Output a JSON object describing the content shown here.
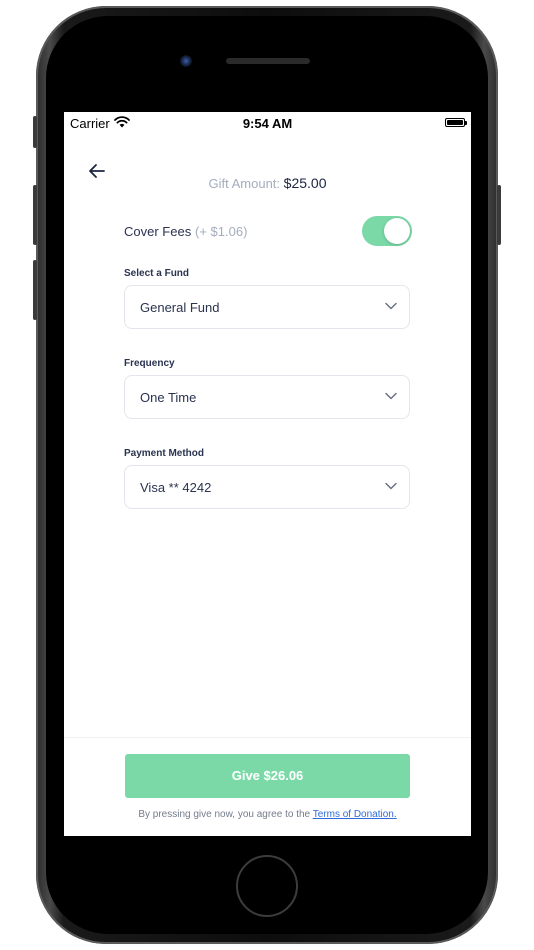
{
  "status_bar": {
    "carrier": "Carrier",
    "time": "9:54 AM",
    "wifi_icon": "wifi-icon",
    "battery_icon": "battery-icon"
  },
  "header": {
    "back_icon": "arrow-left-icon",
    "gift_amount_label": "Gift Amount:",
    "gift_amount_value": "$25.00"
  },
  "cover_fees": {
    "label": "Cover Fees",
    "fee": "(+ $1.06)",
    "enabled": true,
    "toggle_color": "#7bd9a8"
  },
  "fund": {
    "label": "Select a Fund",
    "value": "General Fund"
  },
  "frequency": {
    "label": "Frequency",
    "value": "One Time"
  },
  "payment": {
    "label": "Payment Method",
    "value": "Visa ** 4242"
  },
  "footer": {
    "give_label": "Give $26.06",
    "terms_prefix": "By pressing give now, you agree to the",
    "terms_link": "Terms of Donation.",
    "button_color": "#7bd9a8"
  }
}
